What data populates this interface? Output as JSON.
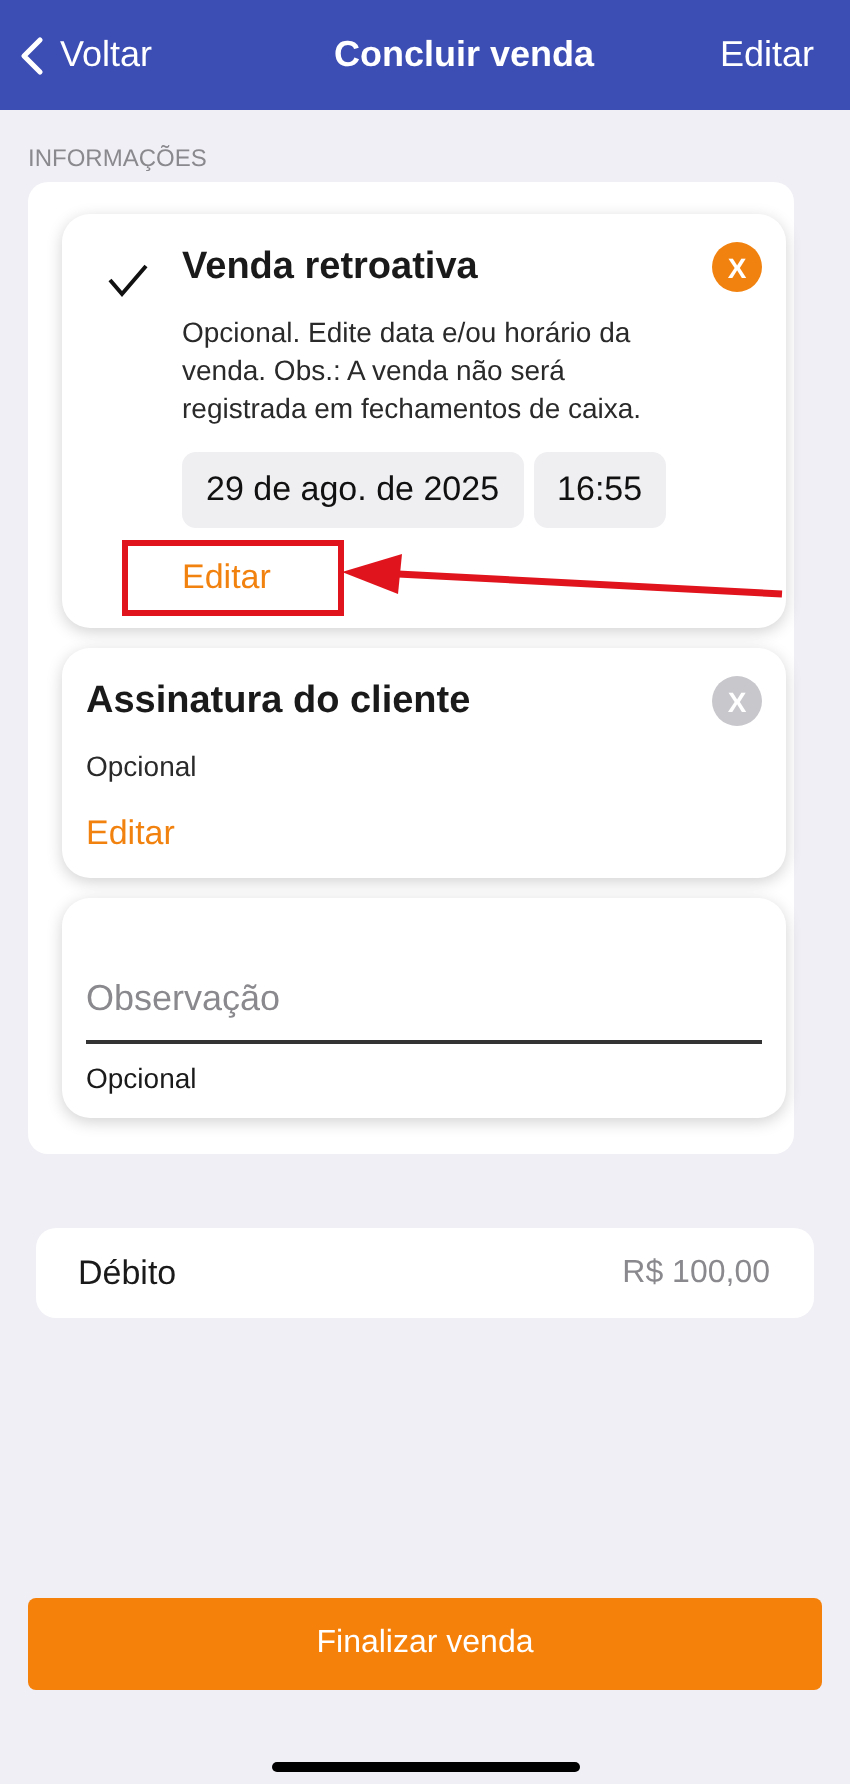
{
  "nav": {
    "back": "Voltar",
    "title": "Concluir venda",
    "action": "Editar"
  },
  "section_label": "INFORMAÇÕES",
  "cards": [
    {
      "kind": "option",
      "checked": true,
      "title": "Venda retroativa",
      "description": "Opcional. Edite data e/ou horário da venda. Obs.: A venda não será registrada em fechamentos de caixa.",
      "chips": [
        "29 de ago. de 2025",
        "16:55"
      ],
      "close": "X",
      "link": "Editar",
      "highlighted": true
    },
    {
      "kind": "option",
      "checked": false,
      "title": "Assinatura do cliente",
      "description": "Opcional",
      "close": "X",
      "link": "Editar",
      "highlighted": false
    },
    {
      "kind": "field",
      "placeholder": "Observação",
      "hint": "Opcional"
    }
  ],
  "payment": {
    "method": "Débito",
    "amount": "R$ 100,00"
  },
  "submit": "Finalizar venda"
}
